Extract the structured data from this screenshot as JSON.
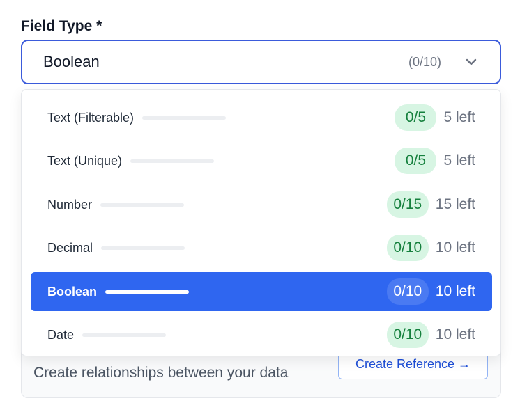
{
  "field": {
    "label": "Field Type *",
    "selected_value": "Boolean",
    "selected_count": "(0/10)",
    "chevron_icon": "chevron-down-icon"
  },
  "dropdown": {
    "options": [
      {
        "label": "Text (Filterable)",
        "badge": "0/5",
        "remaining": "5 left",
        "selected": false
      },
      {
        "label": "Text (Unique)",
        "badge": "0/5",
        "remaining": "5 left",
        "selected": false
      },
      {
        "label": "Number",
        "badge": "0/15",
        "remaining": "15 left",
        "selected": false
      },
      {
        "label": "Decimal",
        "badge": "0/10",
        "remaining": "10 left",
        "selected": false
      },
      {
        "label": "Boolean",
        "badge": "0/10",
        "remaining": "10 left",
        "selected": true
      },
      {
        "label": "Date",
        "badge": "0/10",
        "remaining": "10 left",
        "selected": false
      }
    ]
  },
  "reference_card": {
    "description": "Create relationships between your data",
    "button_label": "Create Reference →"
  },
  "colors": {
    "accent": "#2f66f0",
    "focus_border": "#3b5bdb",
    "badge_bg": "#d7f5e3",
    "badge_text": "#15803d"
  }
}
